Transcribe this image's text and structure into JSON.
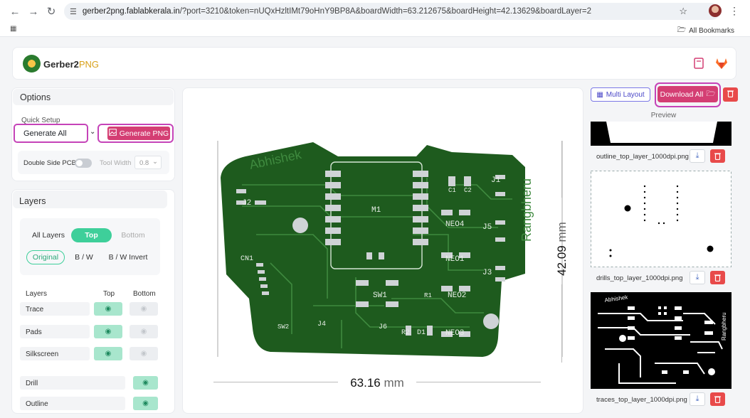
{
  "browser": {
    "url_host": "gerber2png.fablabkerala.in",
    "url_rest": "/?port=3210&token=nUQxHzltIMt79oHnY9BP8A&boardWidth=63.212675&boardHeight=42.13629&boardLayer=2",
    "bookmarks_label": "All Bookmarks"
  },
  "app": {
    "logo_main": "Gerber2",
    "logo_accent": "PNG",
    "accent_color": "#d43e73",
    "board_color": "#1e5b1e"
  },
  "options": {
    "title": "Options",
    "quick_setup_label": "Quick Setup",
    "quick_setup_value": "Generate All",
    "generate_png_label": "Generate PNG",
    "double_side_label": "Double Side PCB",
    "tool_width_label": "Tool Width",
    "tool_width_value": "0.8"
  },
  "layers": {
    "title": "Layers",
    "side_tabs": [
      "All Layers",
      "Top",
      "Bottom"
    ],
    "active_side": "Top",
    "color_tabs": [
      "Original",
      "B / W",
      "B / W Invert"
    ],
    "active_color": "Original",
    "col_layers": "Layers",
    "col_top": "Top",
    "col_bottom": "Bottom",
    "rows": [
      {
        "name": "Trace",
        "top": true,
        "bottom": false
      },
      {
        "name": "Pads",
        "top": true,
        "bottom": false
      },
      {
        "name": "Silkscreen",
        "top": true,
        "bottom": false
      }
    ],
    "extra_rows": [
      {
        "name": "Drill",
        "visible": true
      },
      {
        "name": "Outline",
        "visible": true
      }
    ]
  },
  "viewer": {
    "width_value": "63.16",
    "height_value": "42.09",
    "unit": "mm",
    "silk_name_left": "Abhishek",
    "silk_name_right": "Rangbheru",
    "refs": [
      "J2",
      "M1",
      "J1",
      "C1",
      "C2",
      "NEO4",
      "J5",
      "CN1",
      "NEO1",
      "J3",
      "SW1",
      "R1",
      "NEO2",
      "SW2",
      "J4",
      "J6",
      "R2",
      "D1",
      "NEO3"
    ]
  },
  "right": {
    "multi_layout_label": "Multi Layout",
    "download_all_label": "Download All",
    "preview_label": "Preview",
    "files": [
      "outline_top_layer_1000dpi.png",
      "drills_top_layer_1000dpi.png",
      "traces_top_layer_1000dpi.png"
    ],
    "trace_preview_left_text": "Abhishek",
    "trace_preview_right_text": "Rangbheru"
  }
}
